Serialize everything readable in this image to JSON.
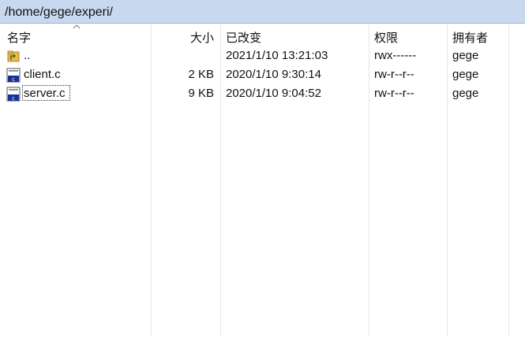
{
  "path_bar": {
    "path": "/home/gege/experi/"
  },
  "columns": {
    "name": "名字",
    "size": "大小",
    "modified": "已改变",
    "permissions": "权限",
    "owner": "拥有者"
  },
  "files": [
    {
      "name": "..",
      "size": "",
      "modified": "2021/1/10 13:21:03",
      "permissions": "rwx------",
      "owner": "gege",
      "icon": "parent-folder-icon"
    },
    {
      "name": "client.c",
      "size": "2 KB",
      "modified": "2020/1/10 9:30:14",
      "permissions": "rw-r--r--",
      "owner": "gege",
      "icon": "c-file-icon"
    },
    {
      "name": "server.c",
      "size": "9 KB",
      "modified": "2020/1/10 9:04:52",
      "permissions": "rw-r--r--",
      "owner": "gege",
      "icon": "c-file-icon"
    }
  ],
  "colors": {
    "path_bar_bg": "#c8d8ee",
    "folder_yellow": "#e8b84a",
    "c_file_blue": "#1a2f9a"
  }
}
